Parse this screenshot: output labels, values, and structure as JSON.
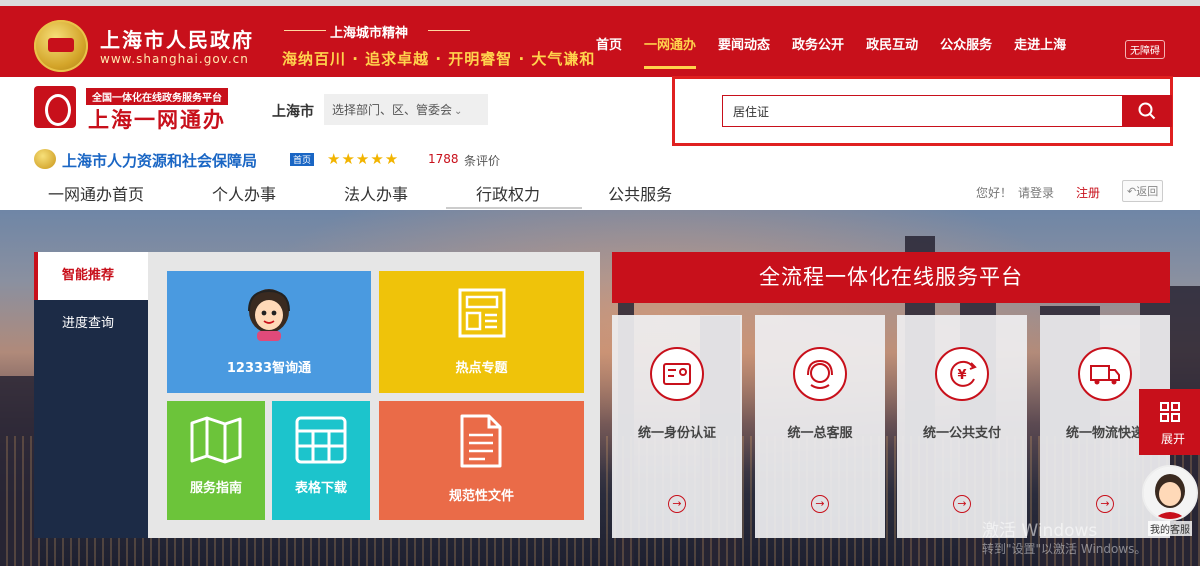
{
  "header": {
    "site_title": "上海市人民政府",
    "site_url": "www.shanghai.gov.cn",
    "spirit_title": "上海城市精神",
    "spirit_slogan": "海纳百川 · 追求卓越 · 开明睿智 · 大气谦和",
    "nav": [
      "首页",
      "一网通办",
      "要闻动态",
      "政务公开",
      "政民互动",
      "公众服务",
      "走进上海"
    ],
    "nav_active": "一网通办",
    "barrier_free": "无障碍",
    "brand_color": "#c8101b",
    "accent_color": "#ffd34d"
  },
  "portal": {
    "tag": "全国一体化在线政务服务平台",
    "name": "上海一网通办",
    "city": "上海市",
    "dept_placeholder": "选择部门、区、管委会"
  },
  "search": {
    "value": "居住证",
    "icon": "search-icon"
  },
  "bureau": {
    "name": "上海市人力资源和社会保障局",
    "badge": "首页",
    "stars": "★★★★★",
    "rating_count": "1788",
    "rating_suffix": "条评价"
  },
  "main_nav": {
    "items": [
      "一网通办首页",
      "个人办事",
      "法人办事",
      "行政权力",
      "公共服务"
    ],
    "greeting": "您好！",
    "login": "请登录",
    "register": "注册",
    "back": "返回"
  },
  "side_tabs": [
    {
      "label": "智能推荐",
      "active": true
    },
    {
      "label": "进度查询",
      "active": false
    }
  ],
  "tiles": [
    {
      "label": "12333智询通",
      "color": "#4a9ae0",
      "icon": "customer-service-avatar-icon"
    },
    {
      "label": "热点专题",
      "color": "#efc30a",
      "icon": "newspaper-icon"
    },
    {
      "label": "服务指南",
      "color": "#6cc43a",
      "icon": "map-icon"
    },
    {
      "label": "表格下载",
      "color": "#1cc4cc",
      "icon": "table-icon"
    },
    {
      "label": "规范性文件",
      "color": "#ea6b48",
      "icon": "document-icon"
    }
  ],
  "platform": {
    "title": "全流程一体化在线服务平台",
    "cards": [
      {
        "label": "统一身份认证",
        "icon": "id-card-icon"
      },
      {
        "label": "统一总客服",
        "icon": "headset-icon"
      },
      {
        "label": "统一公共支付",
        "icon": "yen-payment-icon"
      },
      {
        "label": "统一物流快递",
        "icon": "truck-icon"
      }
    ],
    "arrow": "→"
  },
  "widgets": {
    "expand": "展开",
    "service": "我的客服"
  },
  "watermark": {
    "line1": "激活 Windows",
    "line2": "转到\"设置\"以激活 Windows。"
  }
}
